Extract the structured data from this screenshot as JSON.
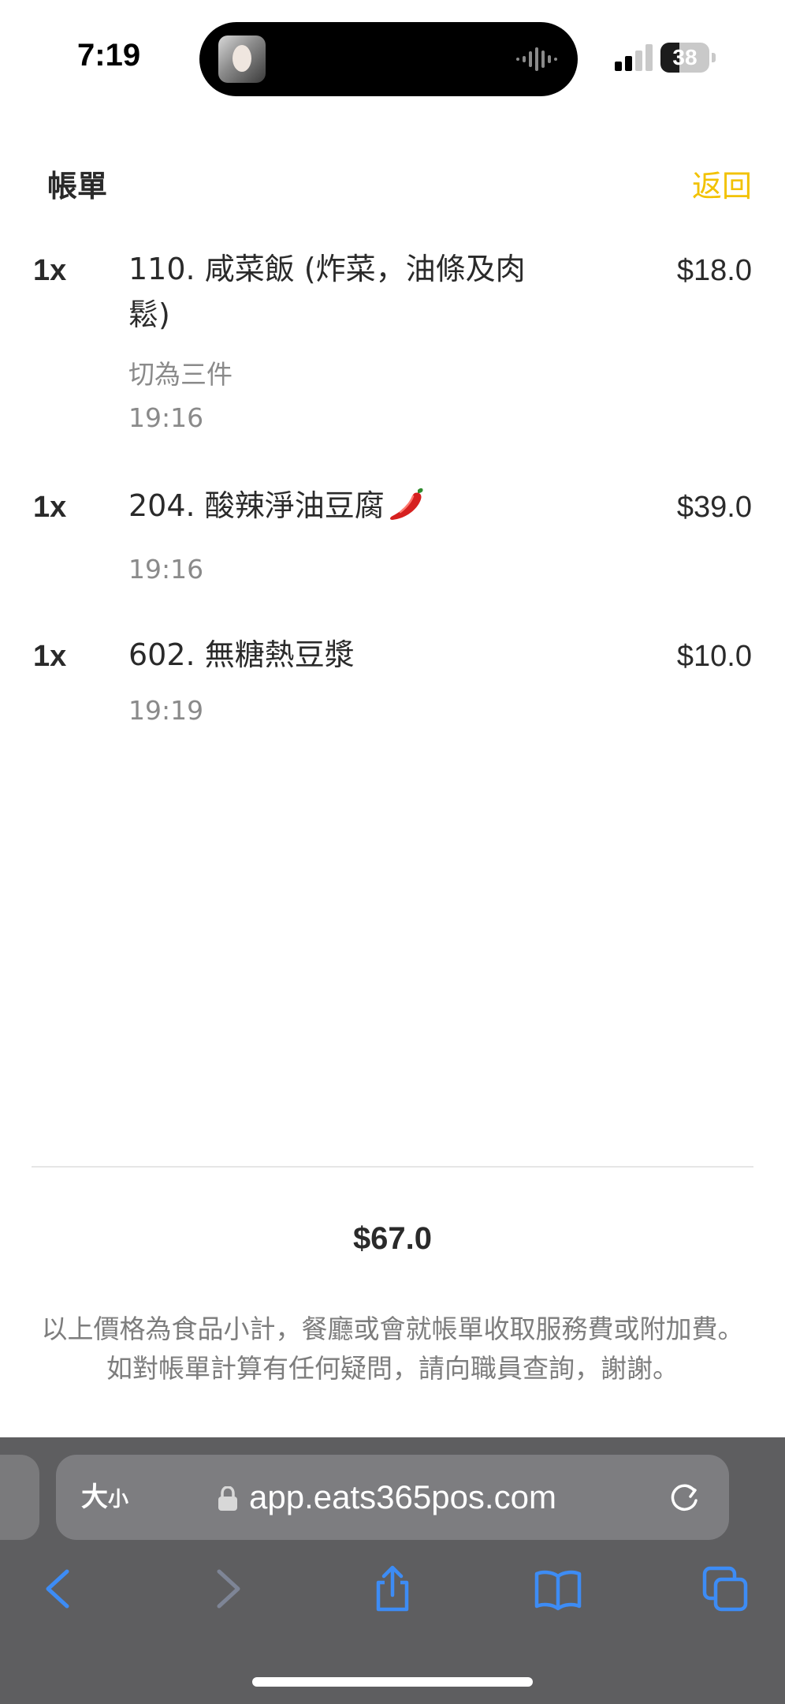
{
  "status_bar": {
    "time": "7:19",
    "battery_level": "38",
    "signal_bars_active": 2,
    "signal_bars_total": 4
  },
  "header": {
    "title": "帳單",
    "back_label": "返回"
  },
  "items": [
    {
      "qty": "1x",
      "name": "110. 咸菜飯 (炸菜，油條及肉鬆)",
      "note": "切為三件",
      "time": "19:16",
      "price": "$18.0"
    },
    {
      "qty": "1x",
      "name": "204. 酸辣淨油豆腐",
      "time": "19:16",
      "price": "$39.0",
      "badge_icon": "chili-pepper-icon"
    },
    {
      "qty": "1x",
      "name": "602. 無糖熱豆漿",
      "time": "19:19",
      "price": "$10.0"
    }
  ],
  "summary": {
    "total": "$67.0",
    "note": "以上價格為食品小計，餐廳或會就帳單收取服務費或附加費。如對帳單計算有任何疑問，請向職員查詢，謝謝。"
  },
  "browser": {
    "text_size_big": "大",
    "text_size_small": "小",
    "url": "app.eats365pos.com",
    "icons": {
      "lock": "lock-icon",
      "reload": "reload-icon",
      "back": "chevron-left-icon",
      "forward": "chevron-right-icon",
      "share": "share-icon",
      "bookmarks": "book-icon",
      "tabs": "tabs-icon"
    }
  },
  "colors": {
    "accent": "#f2c200",
    "text_primary": "#2a2a2a",
    "text_secondary": "#8a8a8a",
    "browser_bar": "#5e5e60",
    "browser_icon_active": "#3d8cf5",
    "browser_icon_disabled": "#7e8596"
  }
}
